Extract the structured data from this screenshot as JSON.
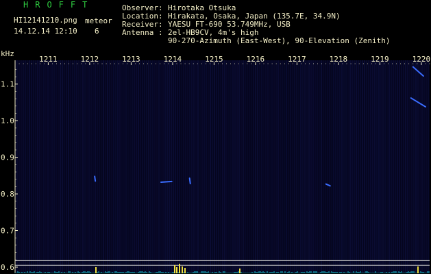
{
  "header": {
    "logo": "HROFFT",
    "filename": "HI12141210.png",
    "date": "14.12.14 12:10",
    "meteor_label": "meteor",
    "meteor_count": "6",
    "observer_label": "Observer",
    "observer": "Hirotaka Otsuka",
    "location_label": "Location",
    "location": "Hirakata, Osaka, Japan (135.7E, 34.9N)",
    "receiver_label": "Receiver",
    "receiver": "YAESU FT-690 53.749MHz, USB",
    "antenna_label": "Antenna",
    "antenna_line1": "2el-HB9CV, 4m's high",
    "antenna_line2": "90-270-Azimuth (East-West), 90-Elevation (Zenith)",
    "separator": ":"
  },
  "colors": {
    "background": "#000000",
    "plot_background": "#05051e",
    "text": "#f5f0c8",
    "logo": "#2ecc40",
    "echo": "#3a6cff",
    "bottom_trace": "#18c8d8",
    "bottom_peak": "#f0e040"
  },
  "chart_data": {
    "type": "heatmap",
    "ylabel": "kHz",
    "x_ticks": [
      "1211",
      "1212",
      "1213",
      "1214",
      "1215",
      "1216",
      "1217",
      "1218",
      "1219",
      "1220"
    ],
    "x_range": [
      1210.2,
      1220.2
    ],
    "y_ticks": [
      "1.1",
      "1.0",
      "0.9",
      "0.8",
      "0.7",
      "0.6"
    ],
    "y_range": [
      0.585,
      1.165
    ],
    "grid": false,
    "echoes": [
      {
        "x_start": 1212.12,
        "x_end": 1212.12,
        "f_start": 0.848,
        "f_end": 0.835
      },
      {
        "x_start": 1213.72,
        "x_end": 1213.98,
        "f_start": 0.832,
        "f_end": 0.834
      },
      {
        "x_start": 1214.41,
        "x_end": 1214.41,
        "f_start": 0.843,
        "f_end": 0.828
      },
      {
        "x_start": 1217.7,
        "x_end": 1217.8,
        "f_start": 0.827,
        "f_end": 0.822
      },
      {
        "x_start": 1219.75,
        "x_end": 1220.1,
        "f_start": 1.062,
        "f_end": 1.038
      },
      {
        "x_start": 1219.8,
        "x_end": 1220.05,
        "f_start": 1.147,
        "f_end": 1.122
      }
    ],
    "reference_lines": [
      0.618,
      0.605
    ]
  }
}
